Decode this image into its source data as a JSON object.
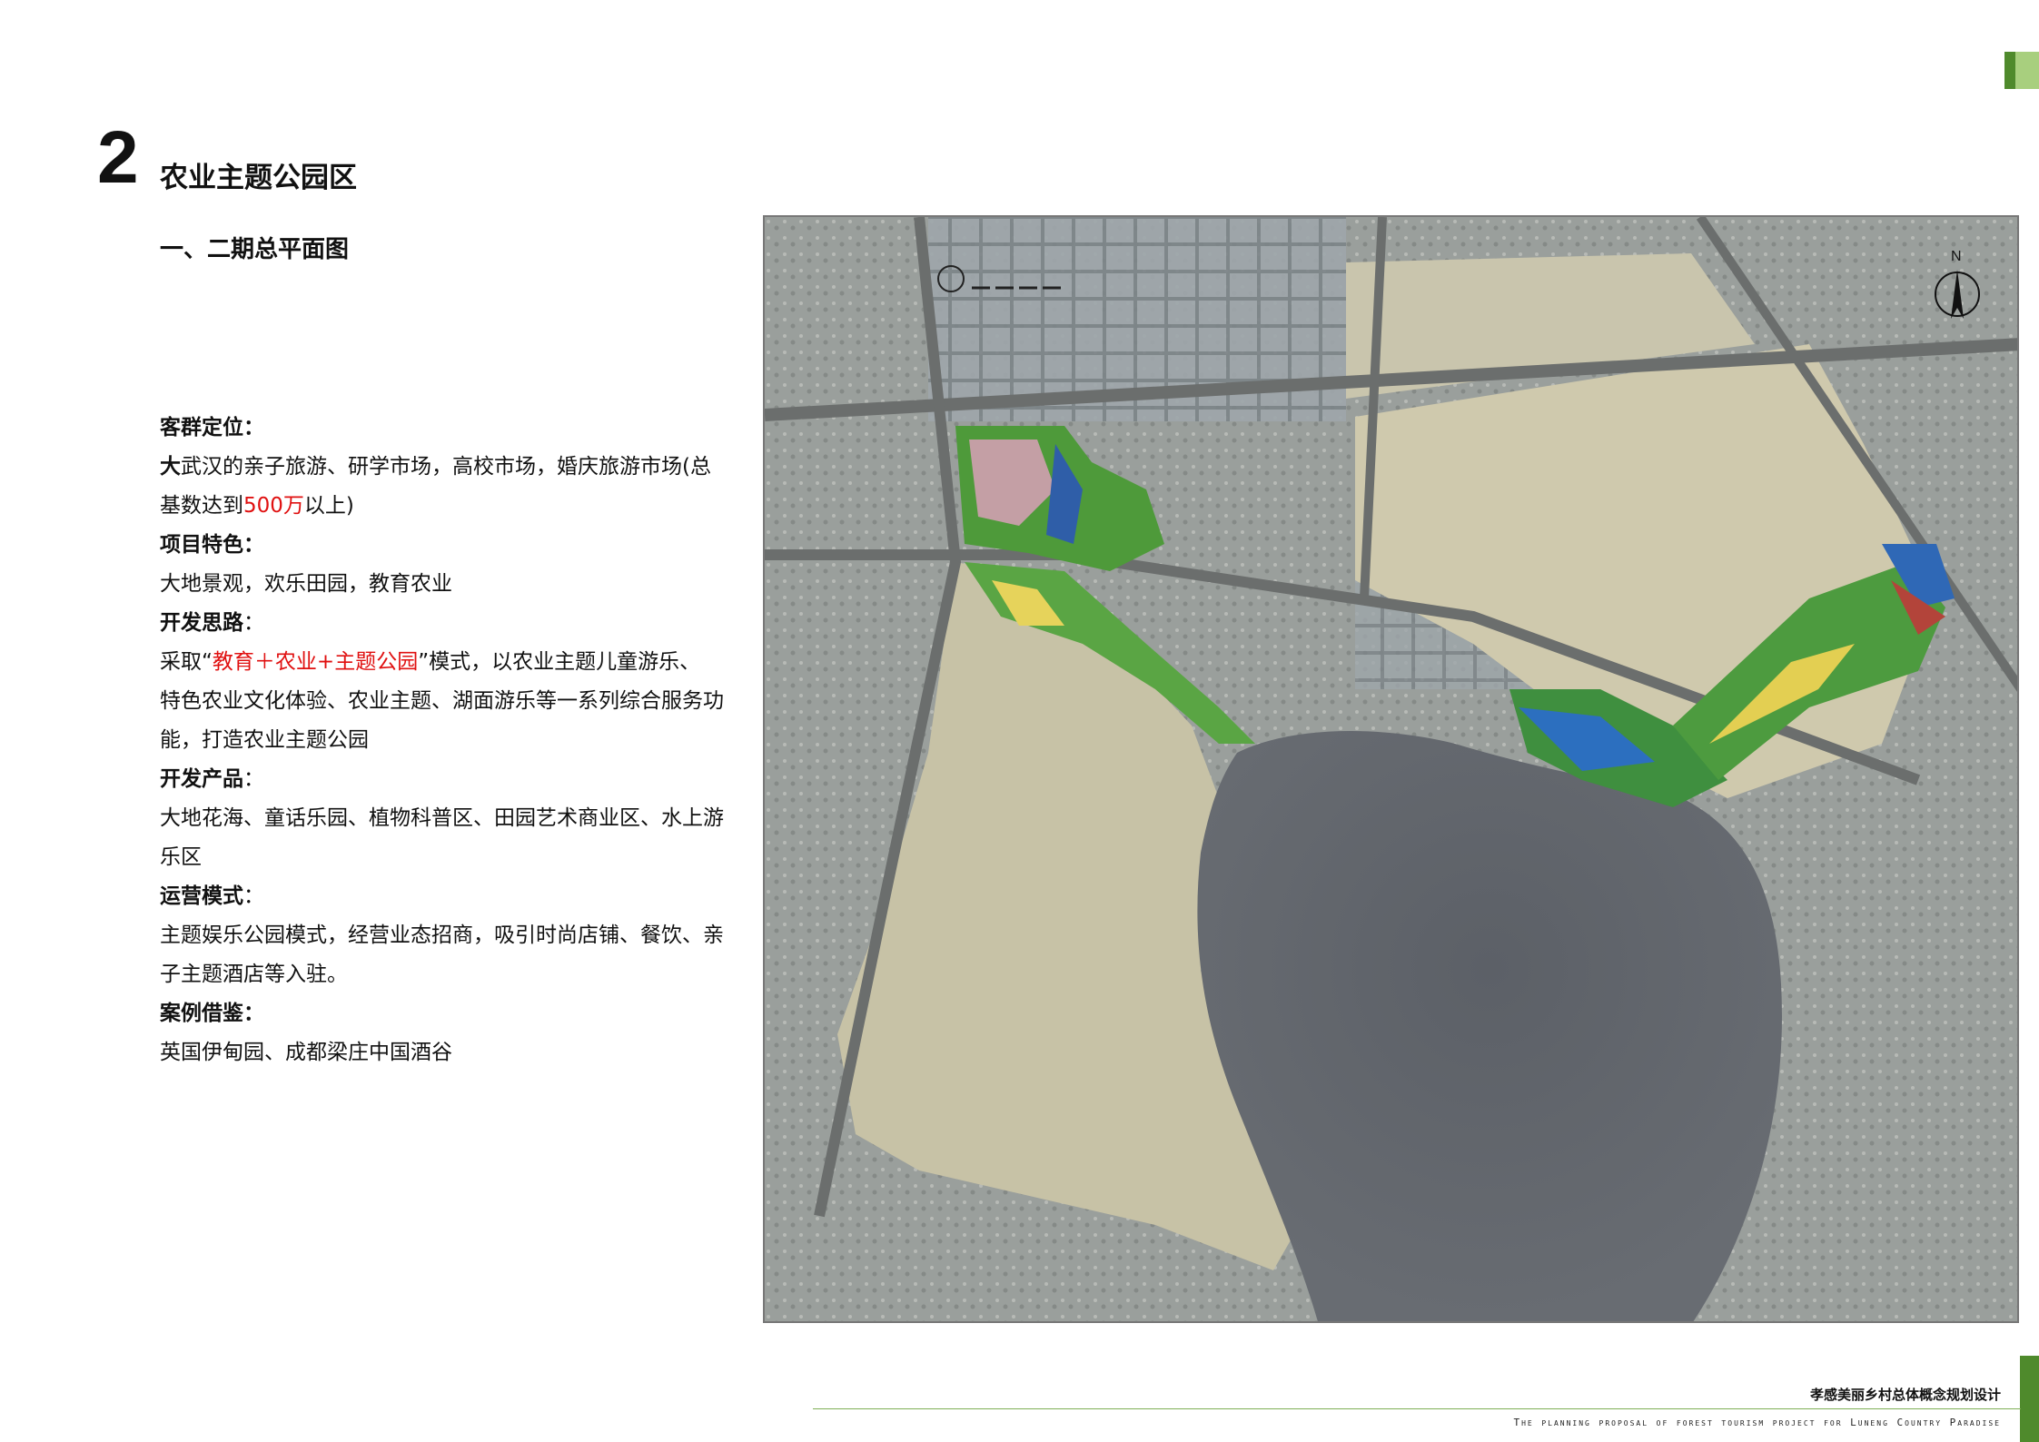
{
  "section": {
    "number": "2",
    "title": "农业主题公园区",
    "subtitle": "一、二期总平面图"
  },
  "content": {
    "customer_heading": "客群定位：",
    "customer_line1_bold": "大",
    "customer_line1_rest": "武汉的亲子旅游、研学市场，高校市场，婚庆旅游市场(总",
    "customer_line2_pre": "基数达到",
    "customer_line2_red": "500万",
    "customer_line2_post": "以上)",
    "feature_heading": "项目特色：",
    "feature_text": "大地景观，欢乐田园，教育农业",
    "idea_heading": "开发思路",
    "idea_colon": "：",
    "idea_line1_pre": "采取“",
    "idea_line1_red": "教育＋农业+主题公园",
    "idea_line1_post": "”模式，以农业主题儿童游乐、",
    "idea_line2": "特色农业文化体验、农业主题、湖面游乐等一系列综合服务功",
    "idea_line3": "能，打造农业主题公园",
    "product_heading": "开发产品",
    "product_colon": "：",
    "product_line1": "大地花海、童话乐园、植物科普区、田园艺术商业区、水上游",
    "product_line2": "乐区",
    "ops_heading": "运营模式",
    "ops_colon": "：",
    "ops_line1": "主题娱乐公园模式，经营业态招商，吸引时尚店铺、餐饮、亲",
    "ops_line2": "子主题酒店等入驻。",
    "case_heading": "案例借鉴：",
    "case_text": "英国伊甸园、成都梁庄中国酒谷"
  },
  "map": {
    "north_label": "N"
  },
  "footer": {
    "cn_title": "孝感美丽乡村总体概念规划设计",
    "en_title": "The planning proposal of forest tourism project for Luneng Country Paradise"
  }
}
